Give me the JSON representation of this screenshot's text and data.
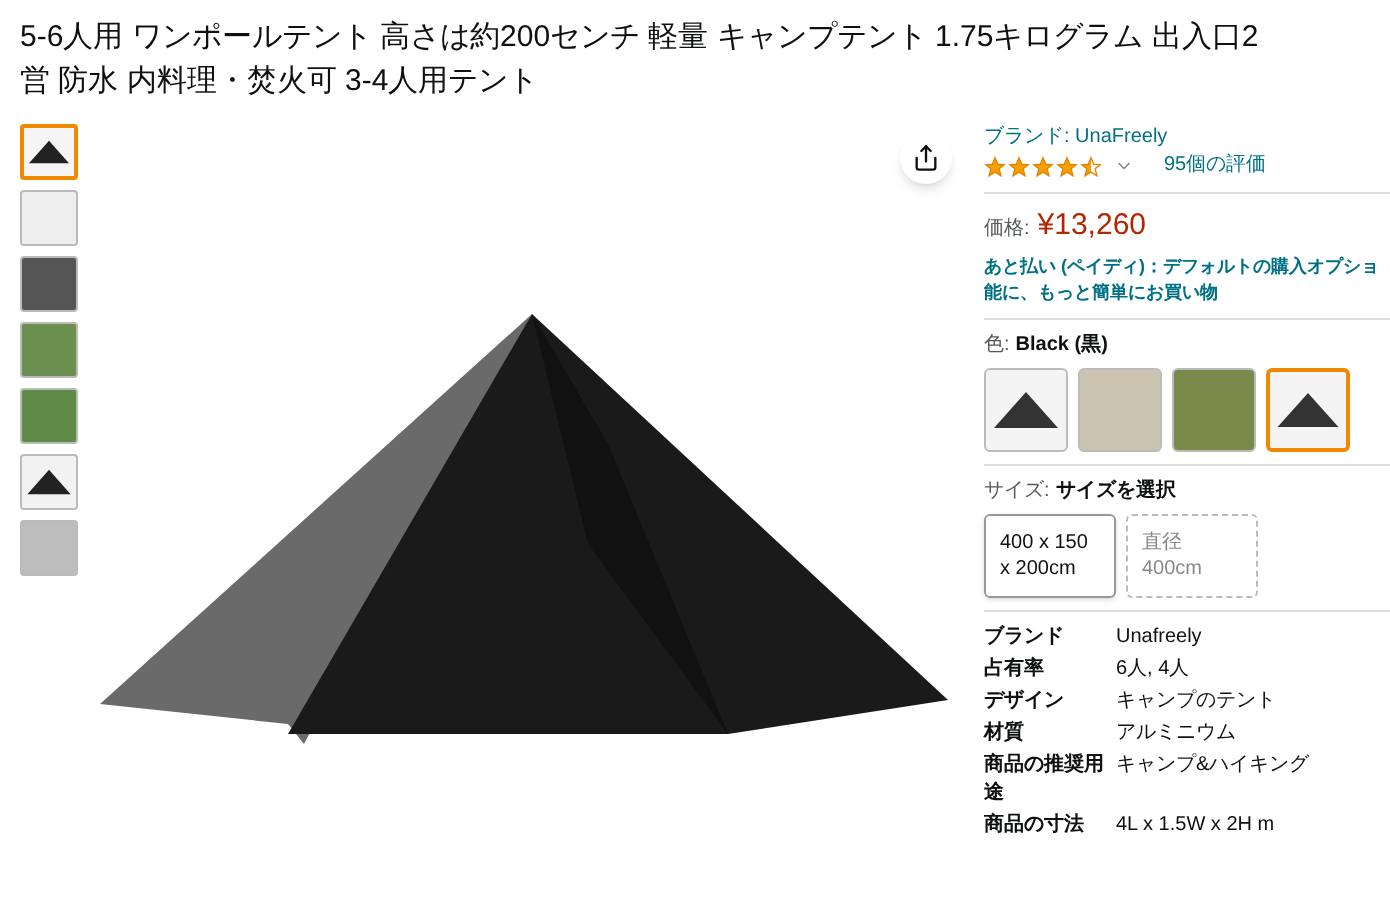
{
  "title_lines": [
    "5-6人用 ワンポールテント 高さは約200センチ 軽量 キャンプテント 1.75キログラム 出入口2",
    "営 防水 内料理・焚火可 3-4人用テント"
  ],
  "thumbnails": [
    {
      "selected": true
    },
    {
      "selected": false
    },
    {
      "selected": false
    },
    {
      "selected": false
    },
    {
      "selected": false
    },
    {
      "selected": false
    },
    {
      "selected": false
    }
  ],
  "brand_link": "ブランド: UnaFreely",
  "rating": {
    "stars": 4.5,
    "count": "95個の評価"
  },
  "price": {
    "label": "価格:",
    "value": "¥13,260"
  },
  "payment_lines": [
    "あと払い (ペイディ)：デフォルトの購入オプショ",
    "能に、もっと簡単にお買い物"
  ],
  "color": {
    "label": "色:",
    "value": "Black (黒)",
    "swatches": [
      {
        "selected": false
      },
      {
        "selected": false
      },
      {
        "selected": false
      },
      {
        "selected": true
      }
    ]
  },
  "size": {
    "label": "サイズ:",
    "value": "サイズを選択",
    "options": [
      {
        "lines": [
          "400 x 150",
          "x 200cm"
        ],
        "available": true
      },
      {
        "lines": [
          "直径",
          "400cm"
        ],
        "available": false
      }
    ]
  },
  "specs": [
    {
      "name": "ブランド",
      "value": "Unafreely"
    },
    {
      "name": "占有率",
      "value": "6人, 4人"
    },
    {
      "name": "デザイン",
      "value": "キャンプのテント"
    },
    {
      "name": "材質",
      "value": "アルミニウム"
    },
    {
      "name": "商品の推奨用途",
      "value": "キャンプ&ハイキング"
    },
    {
      "name": "商品の寸法",
      "value": "4L x 1.5W x 2H m"
    }
  ]
}
